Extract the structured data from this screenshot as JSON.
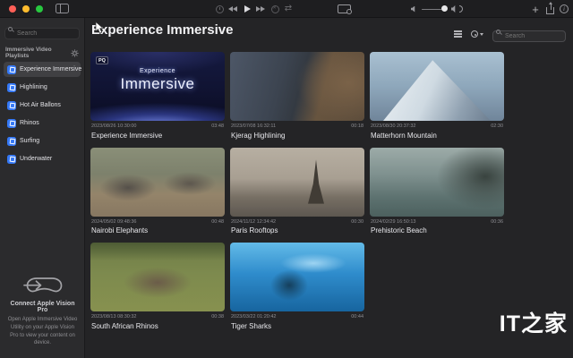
{
  "titlebar": {
    "icons": [
      "timer-icon",
      "rewind-icon",
      "play-icon",
      "fast-forward-icon",
      "stop-icon",
      "shuffle-icon",
      "display-icon",
      "volume-down-icon",
      "volume-slider",
      "volume-up-icon",
      "add-icon",
      "share-icon",
      "info-icon"
    ],
    "traffic_lights": [
      "close",
      "minimize",
      "zoom"
    ]
  },
  "sidebar": {
    "search_placeholder": "Search",
    "section_title": "Immersive Video Playlists",
    "gear_icon": "gear-icon",
    "items": [
      {
        "label": "Experience Immersive",
        "selected": true
      },
      {
        "label": "Highlining",
        "selected": false
      },
      {
        "label": "Hot Air Ballons",
        "selected": false
      },
      {
        "label": "Rhinos",
        "selected": false
      },
      {
        "label": "Surfing",
        "selected": false
      },
      {
        "label": "Underwater",
        "selected": false
      }
    ],
    "footer": {
      "icon": "vision-pro-icon",
      "title": "Connect Apple Vision Pro",
      "description": "Open Apple Immersive Video Utility on your Apple Vision Pro to view your content on device."
    }
  },
  "main": {
    "title": "Experience Immersive",
    "search_placeholder": "Search",
    "videos": [
      {
        "title": "Experience Immersive",
        "date": "2023/08/26 10:30:00",
        "duration": "03:48",
        "badge": "PQ",
        "overlay": {
          "small": "Experience",
          "large": "Immersive"
        },
        "thumb": "experience"
      },
      {
        "title": "Kjerag Highlining",
        "date": "2023/07/08 16:32:11",
        "duration": "00:18",
        "thumb": "kjerag"
      },
      {
        "title": "Matterhorn Mountain",
        "date": "2023/08/30 20:37:32",
        "duration": "02:30",
        "thumb": "matterhorn"
      },
      {
        "title": "Nairobi Elephants",
        "date": "2024/05/02 09:48:36",
        "duration": "00:48",
        "thumb": "elephants"
      },
      {
        "title": "Paris Rooftops",
        "date": "2024/11/12 12:34:42",
        "duration": "00:30",
        "thumb": "paris"
      },
      {
        "title": "Prehistoric Beach",
        "date": "2024/02/29 16:50:13",
        "duration": "00:36",
        "thumb": "beach"
      },
      {
        "title": "South African Rhinos",
        "date": "2023/08/13 08:30:32",
        "duration": "00:38",
        "thumb": "rhinos"
      },
      {
        "title": "Tiger Sharks",
        "date": "2023/03/22 01:20:42",
        "duration": "00:44",
        "thumb": "sharks"
      }
    ]
  },
  "watermark": "IT之家",
  "colors": {
    "accent": "#3478f6",
    "traffic_red": "#ff5f57",
    "traffic_yellow": "#febc2e",
    "traffic_green": "#28c840",
    "titlebar_bg": "#1e1e20",
    "sidebar_bg": "#2b2b2d",
    "main_bg": "#242426"
  }
}
